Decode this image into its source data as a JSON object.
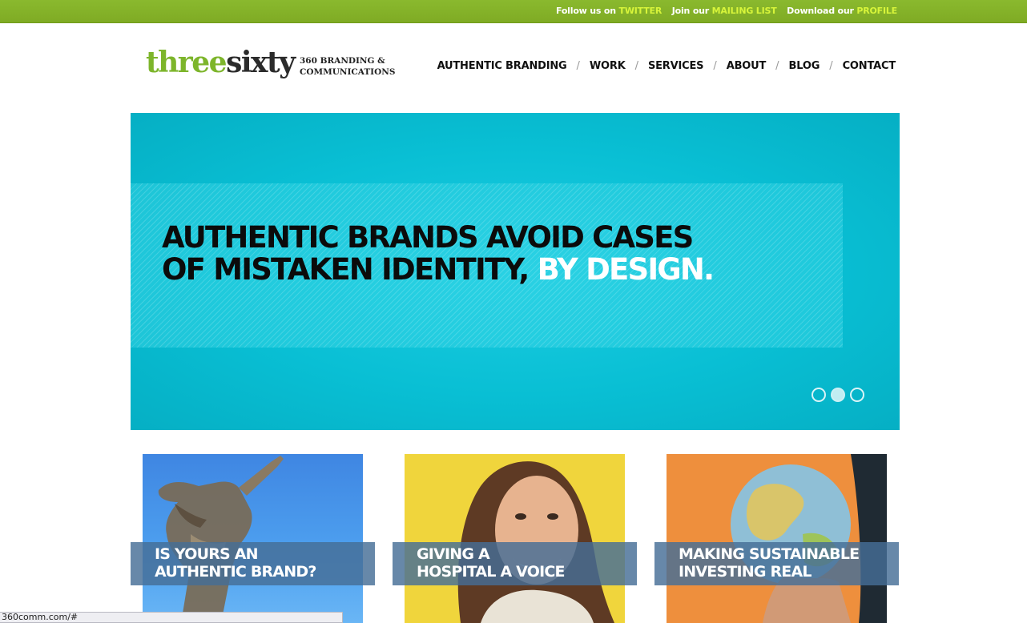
{
  "topbar": {
    "follow_prefix": "Follow us on",
    "follow_link": "TWITTER",
    "join_prefix": "Join our",
    "join_link": "MAILING LIST",
    "download_prefix": "Download our",
    "download_link": "PROFILE"
  },
  "logo": {
    "part1": "three",
    "part2": "sixty",
    "tagline_line1": "360 BRANDING &",
    "tagline_line2": "COMMUNICATIONS"
  },
  "nav": {
    "items": [
      "AUTHENTIC BRANDING",
      "WORK",
      "SERVICES",
      "ABOUT",
      "BLOG",
      "CONTACT"
    ],
    "separator": "/"
  },
  "hero": {
    "headline_line1": "AUTHENTIC BRANDS AVOID CASES",
    "headline_line2": "OF MISTAKEN IDENTITY,",
    "headline_highlight": "BY DESIGN.",
    "slide_count": 3,
    "active_slide": 2
  },
  "tiles": [
    {
      "line1": "IS YOURS AN",
      "line2": "AUTHENTIC BRAND?",
      "image_icon": "statue-photo"
    },
    {
      "line1": "GIVING A",
      "line2": "HOSPITAL A VOICE",
      "image_icon": "woman-portrait-photo"
    },
    {
      "line1": "MAKING SUSTAINABLE",
      "line2": "INVESTING REAL",
      "image_icon": "globe-photo"
    }
  ],
  "colors": {
    "topbar_green": "#8ab92e",
    "link_highlight": "#d8f53a",
    "brand_green": "#7db52b",
    "hero_cyan": "#09bfd4"
  },
  "statusbar": {
    "url": "360comm.com/#"
  }
}
